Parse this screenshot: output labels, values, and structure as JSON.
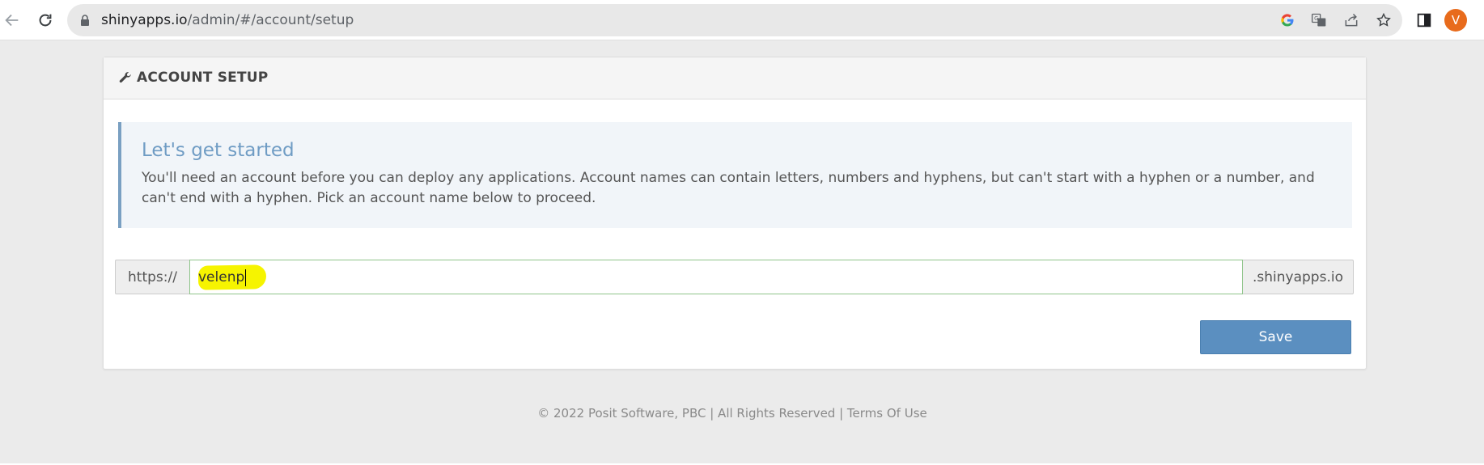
{
  "browser": {
    "url_host": "shinyapps.io",
    "url_path": "/admin/#/account/setup",
    "profile_initial": "V",
    "icons": [
      "back-arrow-icon",
      "reload-icon",
      "lock-icon",
      "google-icon",
      "translate-icon",
      "share-icon",
      "star-icon",
      "side-panel-icon"
    ],
    "colors": {
      "avatar": "#e86b1c"
    }
  },
  "panel": {
    "title": "ACCOUNT SETUP",
    "header_icon": "wrench-icon"
  },
  "callout": {
    "title": "Let's get started",
    "text": "You'll need an account before you can deploy any applications. Account names can contain letters, numbers and hyphens, but can't start with a hyphen or a number, and can't end with a hyphen. Pick an account name below to proceed."
  },
  "account_form": {
    "prefix": "https://",
    "account_name_value": "velenp",
    "suffix": ".shinyapps.io",
    "save_label": "Save"
  },
  "footer": {
    "copyright": "© 2022 Posit Software, PBC | All Rights Reserved | ",
    "terms_link": "Terms Of Use"
  },
  "colors": {
    "accent": "#5b8fc0",
    "callout_title": "#6f9cc4",
    "highlight": "#f6f400",
    "input_border_valid": "#8fc48a"
  }
}
